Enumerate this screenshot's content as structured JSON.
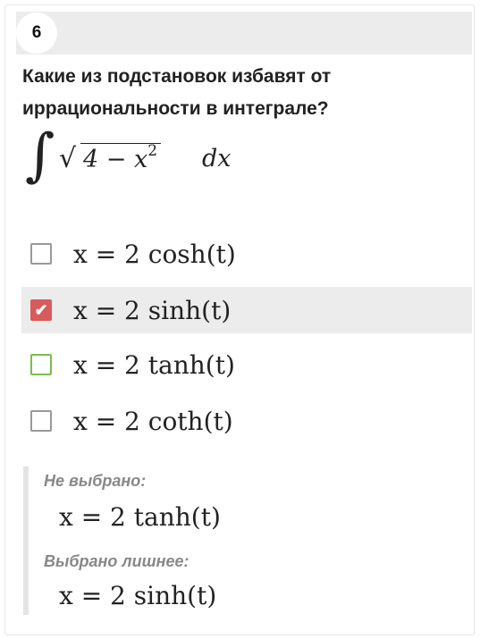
{
  "question": {
    "number": "6",
    "text": "Какие из подстановок избавят от иррациональности в интеграле?",
    "integral": {
      "sign": "∫",
      "radical": "√",
      "expr_base": "4 − x",
      "expr_exp": "2",
      "differential": "dx"
    }
  },
  "options": [
    {
      "label": "x = 2 cosh(t)",
      "checked": false,
      "state": "unchecked"
    },
    {
      "label": "x = 2 sinh(t)",
      "checked": true,
      "state": "checked-wrong"
    },
    {
      "label": "x = 2 tanh(t)",
      "checked": false,
      "state": "missed-correct"
    },
    {
      "label": "x = 2 coth(t)",
      "checked": false,
      "state": "unchecked"
    }
  ],
  "feedback": {
    "not_selected_title": "Не выбрано:",
    "not_selected_value": "x = 2 tanh(t)",
    "extra_selected_title": "Выбрано лишнее:",
    "extra_selected_value": "x = 2 sinh(t)"
  },
  "colors": {
    "checked": "#d85b5b",
    "correct_border": "#7cbc4a",
    "highlight_bg": "#ececec",
    "feedback_text": "#888888"
  }
}
